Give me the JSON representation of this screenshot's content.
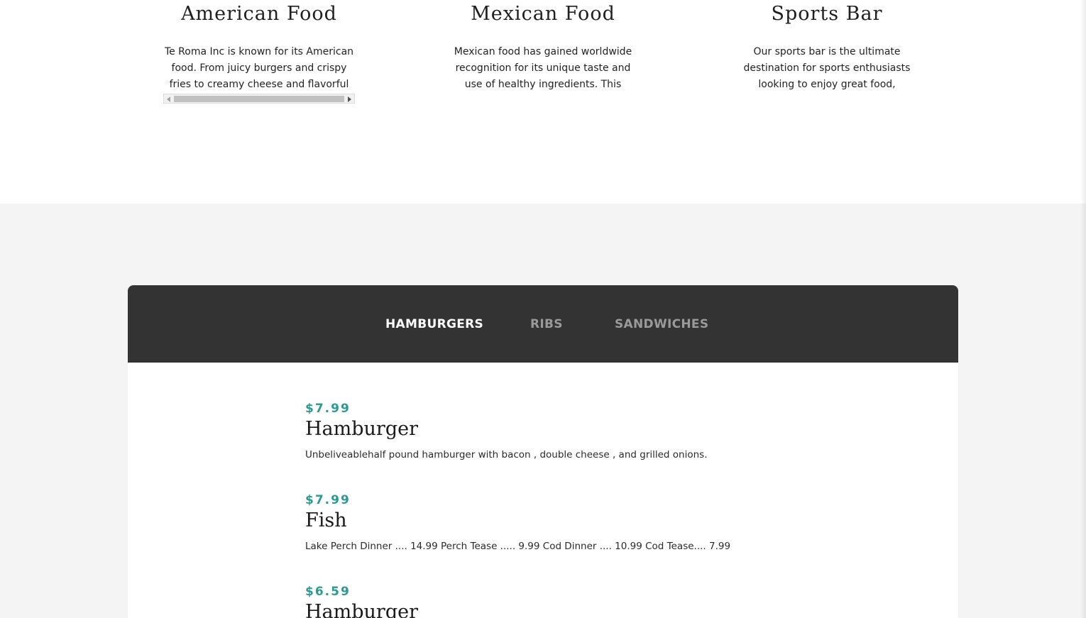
{
  "features": [
    {
      "title": "American Food",
      "text": "Te Roma Inc is known for its American food. From juicy burgers and crispy fries to creamy cheese and flavorful ribs, our..."
    },
    {
      "title": "Mexican Food",
      "text": "Mexican food has gained worldwide recognition for its unique taste and use of healthy ingredients. This traditional..."
    },
    {
      "title": "Sports Bar",
      "text": "Our sports bar is the ultimate destination for sports enthusiasts looking to enjoy great food, refreshing drinks, and an..."
    }
  ],
  "menu": {
    "tabs": [
      {
        "label": "HAMBURGERS",
        "active": true
      },
      {
        "label": "RIBS",
        "active": false
      },
      {
        "label": "SANDWICHES",
        "active": false
      }
    ],
    "items": [
      {
        "price": "$7.99",
        "name": "Hamburger",
        "description": "Unbeliveablehalf pound hamburger with bacon , double cheese , and grilled onions."
      },
      {
        "price": "$7.99",
        "name": "Fish",
        "description": "Lake Perch Dinner .... 14.99 Perch Tease ..... 9.99 Cod Dinner .... 10.99 Cod Tease.... 7.99"
      },
      {
        "price": "$6.59",
        "name": "Hamburger",
        "description": ""
      }
    ]
  },
  "colors": {
    "accent": "#2b9a93",
    "tab_bar": "#333333",
    "section_bg": "#f4f4f4"
  }
}
